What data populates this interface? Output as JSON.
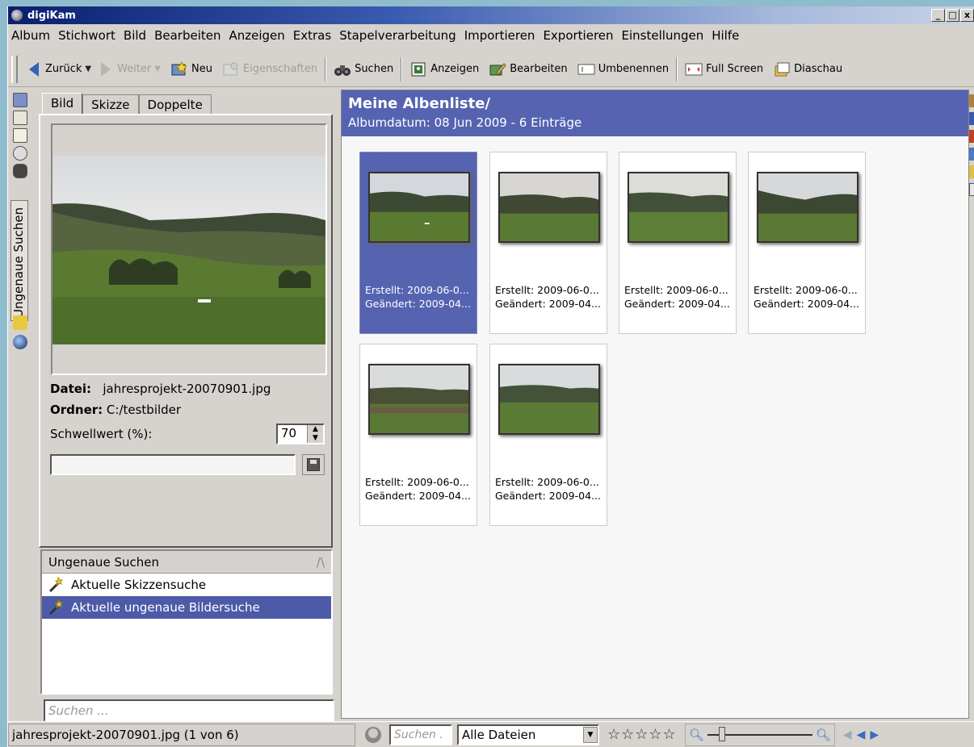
{
  "window": {
    "title": "digiKam",
    "buttons": [
      "_",
      "□",
      "x"
    ]
  },
  "menu": [
    "Album",
    "Stichwort",
    "Bild",
    "Bearbeiten",
    "Anzeigen",
    "Extras",
    "Stapelverarbeitung",
    "Importieren",
    "Exportieren",
    "Einstellungen",
    "Hilfe"
  ],
  "toolbar": {
    "back": "Zurück",
    "forward": "Weiter",
    "new": "Neu",
    "properties": "Eigenschaften",
    "search": "Suchen",
    "view": "Anzeigen",
    "edit": "Bearbeiten",
    "rename": "Umbenennen",
    "fullscreen": "Full Screen",
    "slideshow": "Diaschau"
  },
  "sidebar": {
    "vertical_tab": "Ungenaue Suchen"
  },
  "leftpanel": {
    "tabs": [
      "Bild",
      "Skizze",
      "Doppelte"
    ],
    "file_label": "Datei:",
    "file_value": "jahresprojekt-20070901.jpg",
    "folder_label": "Ordner:",
    "folder_value": "C:/testbilder",
    "threshold_label": "Schwellwert (%):",
    "threshold_value": "70",
    "list_header": "Ungenaue Suchen",
    "list_items": [
      "Aktuelle Skizzensuche",
      "Aktuelle ungenaue Bildersuche"
    ],
    "search_placeholder": "Suchen ..."
  },
  "album": {
    "title": "Meine Albenliste/",
    "subtitle": "Albumdatum: 08 Jun 2009 - 6 Einträge",
    "items": [
      {
        "created": "Erstellt: 2009-06-0...",
        "modified": "Geändert: 2009-04..."
      },
      {
        "created": "Erstellt: 2009-06-0...",
        "modified": "Geändert: 2009-04..."
      },
      {
        "created": "Erstellt: 2009-06-0...",
        "modified": "Geändert: 2009-04..."
      },
      {
        "created": "Erstellt: 2009-06-0...",
        "modified": "Geändert: 2009-04..."
      },
      {
        "created": "Erstellt: 2009-06-0...",
        "modified": "Geändert: 2009-04..."
      },
      {
        "created": "Erstellt: 2009-06-0...",
        "modified": "Geändert: 2009-04..."
      }
    ]
  },
  "statusbar": {
    "text": "jahresprojekt-20070901.jpg (1 von 6)",
    "search_placeholder": "Suchen .",
    "filter": "Alle Dateien",
    "stars": "☆☆☆☆☆"
  }
}
